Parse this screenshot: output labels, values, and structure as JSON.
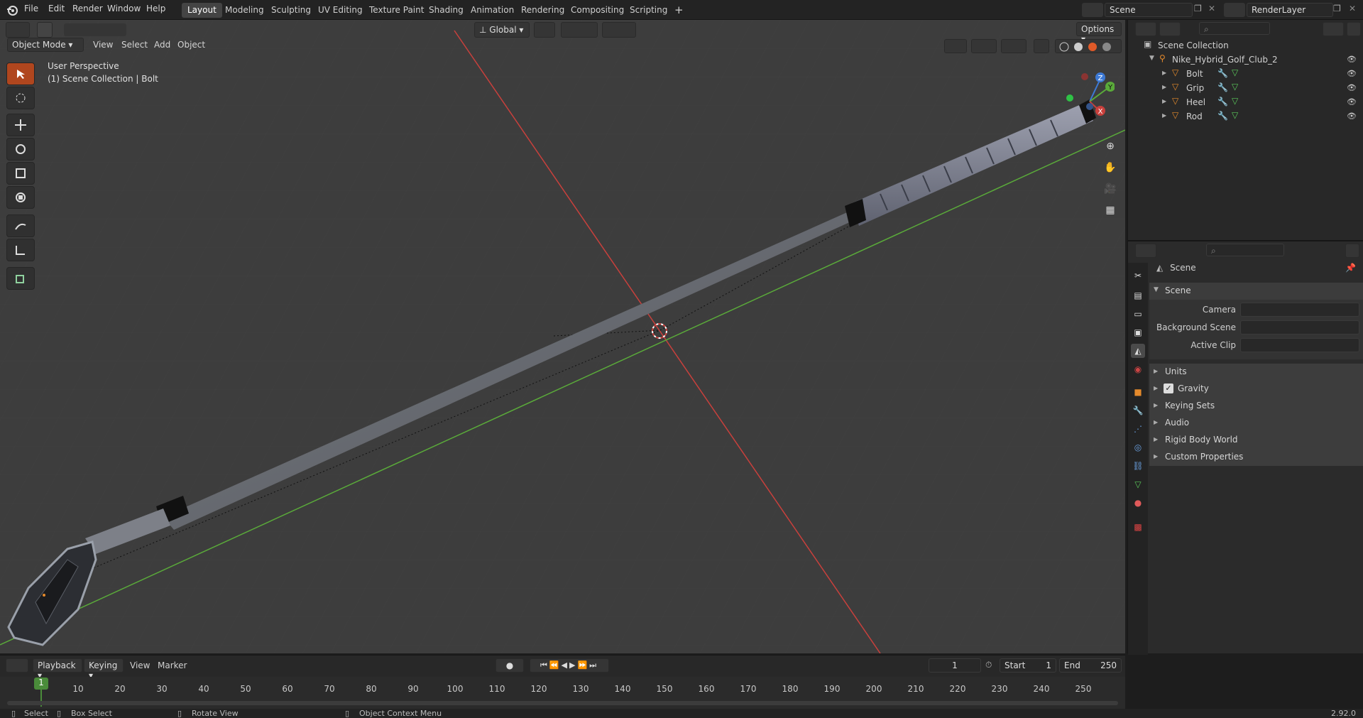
{
  "menu": [
    "File",
    "Edit",
    "Render",
    "Window",
    "Help"
  ],
  "workspaces": [
    "Layout",
    "Modeling",
    "Sculpting",
    "UV Editing",
    "Texture Paint",
    "Shading",
    "Animation",
    "Rendering",
    "Compositing",
    "Scripting"
  ],
  "active_workspace": "Layout",
  "scene_name": "Scene",
  "render_layer": "RenderLayer",
  "viewport": {
    "mode": "Object Mode",
    "menus": [
      "View",
      "Select",
      "Add",
      "Object"
    ],
    "orientation": "Global",
    "options_label": "Options",
    "overlay_text_1": "User Perspective",
    "overlay_text_2": "(1) Scene Collection | Bolt",
    "gizmo": {
      "x": "X",
      "y": "Y",
      "z": "Z"
    }
  },
  "outliner": {
    "root": "Scene Collection",
    "collection": "Nike_Hybrid_Golf_Club_2",
    "objects": [
      "Bolt",
      "Grip",
      "Heel",
      "Rod"
    ]
  },
  "properties": {
    "breadcrumb": "Scene",
    "section": "Scene",
    "fields": [
      {
        "label": "Camera",
        "value": ""
      },
      {
        "label": "Background Scene",
        "value": ""
      },
      {
        "label": "Active Clip",
        "value": ""
      }
    ],
    "panels": [
      "Units",
      "Gravity",
      "Keying Sets",
      "Audio",
      "Rigid Body World",
      "Custom Properties"
    ],
    "gravity_checked": true
  },
  "timeline": {
    "menus": [
      "Playback",
      "Keying",
      "View",
      "Marker"
    ],
    "current_frame": "1",
    "start_label": "Start",
    "start": "1",
    "end_label": "End",
    "end": "250",
    "ticks": [
      "10",
      "20",
      "30",
      "40",
      "50",
      "60",
      "70",
      "80",
      "90",
      "100",
      "110",
      "120",
      "130",
      "140",
      "150",
      "160",
      "170",
      "180",
      "190",
      "200",
      "210",
      "220",
      "230",
      "240",
      "250"
    ],
    "playhead": "1"
  },
  "statusbar": {
    "select": "Select",
    "box_select": "Box Select",
    "rotate": "Rotate View",
    "context": "Object Context Menu",
    "version": "2.92.0"
  },
  "colors": {
    "accent": "#b0461e",
    "x_axis": "#c9403c",
    "y_axis": "#5aaa3a",
    "z_axis": "#3d79d4",
    "object_icon": "#e58a2c"
  }
}
